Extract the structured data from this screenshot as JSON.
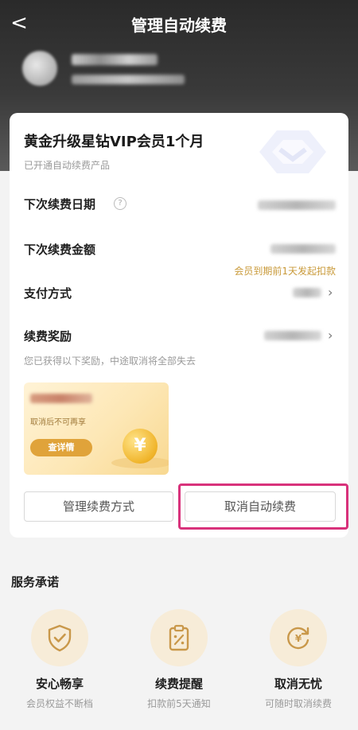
{
  "header": {
    "back_glyph": "<",
    "title": "管理自动续费"
  },
  "card": {
    "product_title": "黄金升级星钻VIP会员1个月",
    "product_status": "已开通自动续费产品",
    "rows": {
      "next_date_label": "下次续费日期",
      "next_amount_label": "下次续费金额",
      "payment_label": "支付方式",
      "reward_label": "续费奖励"
    },
    "deduct_note": "会员到期前1天发起扣款",
    "reward_note": "您已获得以下奖励，中途取消将全部失去",
    "coupon": {
      "subtitle": "取消后不可再享",
      "button_label": "查详情",
      "coin_glyph": "¥"
    },
    "buttons": {
      "manage_method": "管理续费方式",
      "cancel_auto": "取消自动续费"
    },
    "highlight_color": "#d8327b"
  },
  "service": {
    "section_title": "服务承诺",
    "items": [
      {
        "icon": "shield-check-icon",
        "title": "安心畅享",
        "subtitle": "会员权益不断档"
      },
      {
        "icon": "clipboard-percent-icon",
        "title": "续费提醒",
        "subtitle": "扣款前5天通知"
      },
      {
        "icon": "refresh-yuan-icon",
        "title": "取消无忧",
        "subtitle": "可随时取消续费"
      }
    ],
    "accent_color": "#c9984a"
  }
}
